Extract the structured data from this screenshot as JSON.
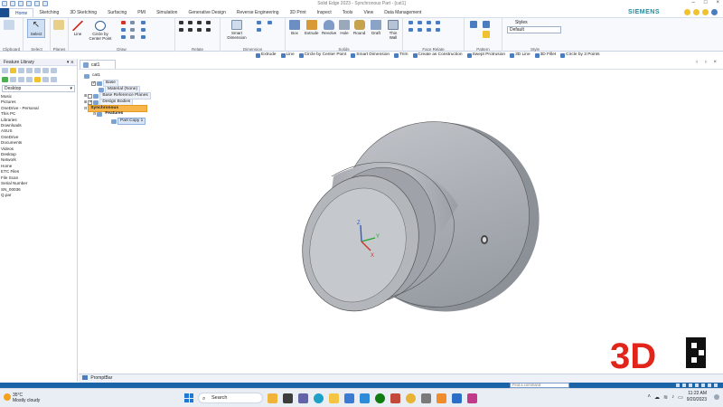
{
  "window": {
    "title": "Solid Edge 2023 - Synchronous Part - [cat1]"
  },
  "ribbon": {
    "tabs": [
      "Home",
      "Sketching",
      "3D Sketching",
      "Surfacing",
      "PMI",
      "Simulation",
      "Generative Design",
      "Reverse Engineering",
      "3D Print",
      "Inspect",
      "Tools",
      "View",
      "Data Management"
    ],
    "brand": "SIEMENS",
    "groups": {
      "clipboard": "Clipboard",
      "select": "Select",
      "planes": "Planes",
      "draw": "Draw",
      "relate": "Relate",
      "dimension": "Dimension",
      "solids": "Solids",
      "face_relate": "Face Relate",
      "pattern": "Pattern",
      "style": "Style"
    },
    "tools": {
      "select": "Select",
      "line": "Line",
      "circle": "Circle by Center Point",
      "smart_dimension": "Smart Dimension",
      "box": "Box",
      "extrude": "Extrude",
      "revolve": "Revolve",
      "hole": "Hole",
      "round": "Round",
      "draft": "Draft",
      "thin_wall": "Thin Wall"
    },
    "styles_label": "Styles",
    "style_value": "Default"
  },
  "command_bar": {
    "items": [
      "Extrude",
      "Line",
      "Circle by Center Point",
      "Smart Dimension",
      "Trim",
      "Create as Construction",
      "Swept Protrusion",
      "3D Line",
      "3D Fillet",
      "Circle by 3 Points"
    ]
  },
  "left_panel": {
    "title": "Feature Library",
    "location": "Desktop",
    "items": [
      "Music",
      "Pictures",
      "OneDrive - Personal",
      "This PC",
      "Libraries",
      "Downloads",
      "ASUS",
      "OneDrive",
      "Documents",
      "Videos",
      "Desktop",
      "Network",
      "Home",
      "ETC Files",
      "File Scan",
      "Serial Number",
      "SN_00036",
      "Q.par"
    ]
  },
  "doc_tab": "cat1",
  "tree": {
    "root": "cat1",
    "base": "Base",
    "material": "Material (None)",
    "base_planes": "Base Reference Planes",
    "design_bodies": "Design Bodies",
    "synchronous": "Synchronous",
    "features": "Features",
    "part_copy": "Part Copy 1"
  },
  "axes": {
    "x": "X",
    "y": "Y",
    "z": "Z"
  },
  "watermark": "3D",
  "prompt_bar": "PromptBar",
  "status": {
    "find_placeholder": "Find a command"
  },
  "taskbar": {
    "temperature": "35°C",
    "weather": "Mostly cloudy",
    "search": "Search",
    "time": "11:22 AM",
    "date": "9/20/2023"
  },
  "colors": {
    "ribbon_accent": "#1b4e91",
    "synchronous_highlight": "#f8b64a",
    "statusbar": "#1b64a8",
    "model_gray": "#a8acb3",
    "watermark_red": "#e1251b"
  }
}
